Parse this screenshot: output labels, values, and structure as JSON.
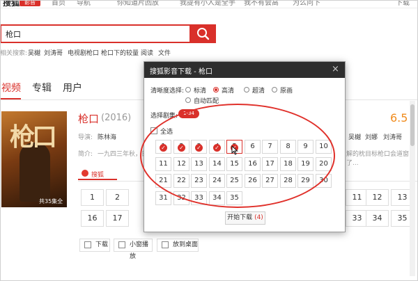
{
  "header": {
    "brand": "搜狐",
    "brand_tag": "影音",
    "nav": [
      "首页",
      "导航",
      "你知道片回放",
      "我提有小人是全手",
      "我不有会高",
      "为么问下",
      "下载"
    ]
  },
  "search": {
    "query": "枪口",
    "hot_label": "相关搜索:",
    "hot_terms": [
      "吴樾",
      "刘涛哥",
      "电视剧枪口",
      "枪口下的较量",
      "阅读",
      "文件"
    ]
  },
  "tabs": [
    "视频",
    "专辑",
    "用户"
  ],
  "movie": {
    "poster_title": "枪口",
    "poster_caption": "共35集全",
    "title": "枪口",
    "year": "(2016)",
    "score": "6.5",
    "director_label": "导演:",
    "director": "陈林海",
    "intro_label": "简介:",
    "intro": "一九四三年秋，日...",
    "cast": [
      "吴樾",
      "刘娜",
      "刘涛哥"
    ],
    "intro_tail": "解的枕目标枪口会道窗了...",
    "source_label": "搜狐"
  },
  "episodes": [
    "1",
    "2",
    "3",
    "4",
    "5",
    "6",
    "7",
    "8",
    "9",
    "10",
    "11",
    "12",
    "13",
    "14",
    "15",
    "16",
    "17",
    "18",
    "19",
    "20",
    "21",
    "22",
    "23",
    "24",
    "25",
    "26",
    "27",
    "28",
    "29",
    "30",
    "31",
    "32",
    "33",
    "34",
    "35"
  ],
  "bg_episodes": {
    "row1_left": [
      "1",
      "2"
    ],
    "row1_right": [
      "11",
      "12",
      "13"
    ],
    "row2_left": [
      "16",
      "17"
    ],
    "row2_right": [
      "33",
      "34",
      "35"
    ]
  },
  "actions": {
    "download": "下载",
    "mini_play": "小窗播放",
    "desktop": "放到桌面"
  },
  "dialog": {
    "title": "搜狐影音下载 - 枪口",
    "close": "×",
    "quality_label": "清晰度选择:",
    "quality_options": [
      "标清",
      "高清",
      "超清",
      "原画",
      "自动匹配"
    ],
    "quality_selected": "高清",
    "episode_label": "选择剧集:",
    "episode_badge": "1-34",
    "select_all": "全选",
    "checked_episodes": [
      1,
      2,
      3,
      4,
      5
    ],
    "tick_glyph": "✓",
    "start_download": "开始下载",
    "download_count": "(4)"
  },
  "colors": {
    "accent": "#d9302a",
    "score": "#f08c1e",
    "dialog_header": "#2e2e2e"
  }
}
